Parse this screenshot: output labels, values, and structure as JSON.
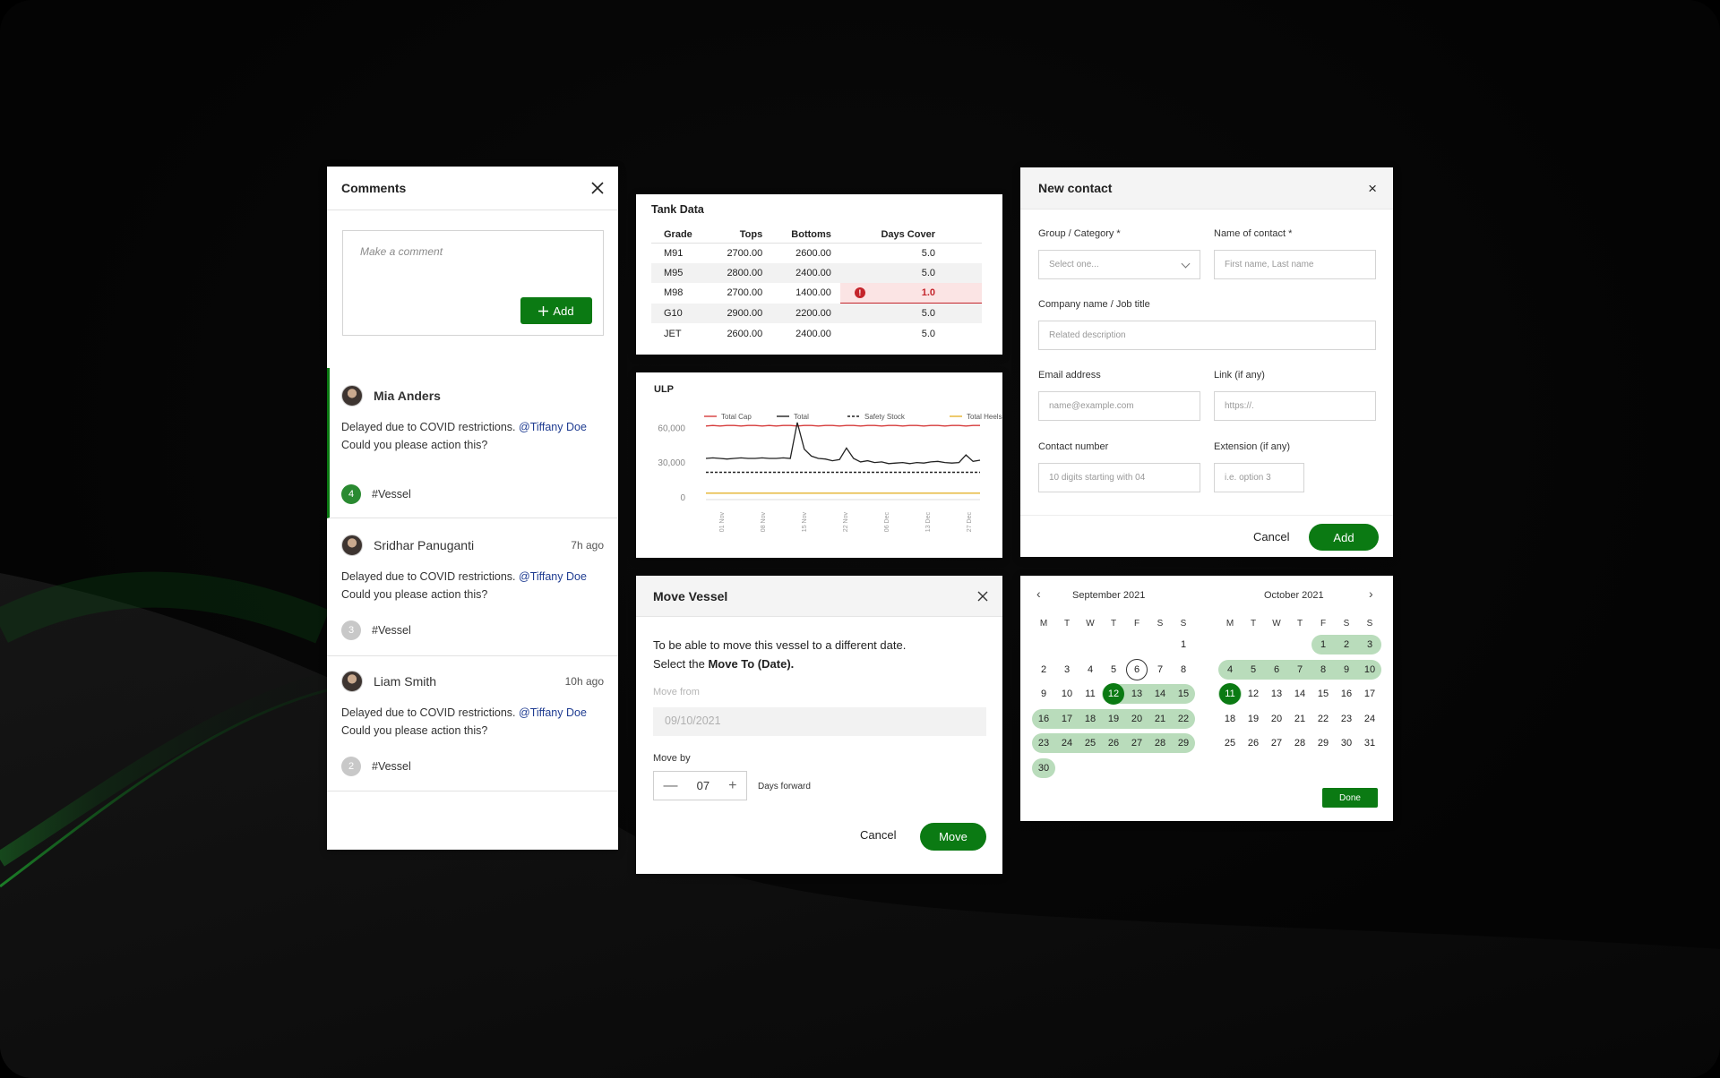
{
  "comments": {
    "title": "Comments",
    "placeholder": "Make a comment",
    "add_label": "Add",
    "items": [
      {
        "name": "Mia Anders",
        "time": "",
        "text1": "Delayed due to COVID restrictions. ",
        "mention": "@Tiffany Doe",
        "text2": "Could you please action this?",
        "count": "4",
        "tag": "#Vessel"
      },
      {
        "name": "Sridhar Panuganti",
        "time": "7h ago",
        "text1": "Delayed due to COVID restrictions. ",
        "mention": "@Tiffany Doe",
        "text2": "Could you please action this?",
        "count": "3",
        "tag": "#Vessel"
      },
      {
        "name": "Liam Smith",
        "time": "10h ago",
        "text1": "Delayed due to COVID restrictions. ",
        "mention": "@Tiffany Doe",
        "text2": "Could you please action this?",
        "count": "2",
        "tag": "#Vessel"
      }
    ]
  },
  "tank": {
    "title": "Tank Data",
    "headers": [
      "Grade",
      "Tops",
      "Bottoms",
      "Days Cover"
    ],
    "rows": [
      [
        "M91",
        "2700.00",
        "2600.00",
        "5.0"
      ],
      [
        "M95",
        "2800.00",
        "2400.00",
        "5.0"
      ],
      [
        "M98",
        "2700.00",
        "1400.00",
        "1.0"
      ],
      [
        "G10",
        "2900.00",
        "2200.00",
        "5.0"
      ],
      [
        "JET",
        "2600.00",
        "2400.00",
        "5.0"
      ]
    ],
    "warning_mark": "!"
  },
  "chart_data": {
    "type": "line",
    "title": "ULP",
    "x": [
      "01 Nov",
      "08 Nov",
      "15 Nov",
      "22 Nov",
      "06 Dec",
      "13 Dec",
      "27 Dec"
    ],
    "y_ticks": [
      "60,000",
      "30,000",
      "0"
    ],
    "ylim": [
      0,
      75000
    ],
    "series": [
      {
        "name": "Total Cap",
        "color": "#d63b3b",
        "style": "solid",
        "values": [
          62000,
          62500,
          62000,
          62500,
          62500,
          62000,
          62500,
          62500,
          62000,
          62500,
          62000,
          62500,
          62500,
          62000,
          62500,
          62500,
          62000,
          62500,
          62500,
          62000,
          62500,
          62500,
          62000,
          62500,
          62500,
          62000,
          62500,
          62500,
          62000,
          62500,
          62500,
          62000,
          62500,
          62500,
          62000,
          62500,
          62500,
          62000,
          62500,
          62500
        ]
      },
      {
        "name": "Total",
        "color": "#222222",
        "style": "solid",
        "values": [
          34000,
          34500,
          34000,
          33500,
          34000,
          34500,
          34000,
          34000,
          34500,
          34000,
          34000,
          34500,
          34000,
          65000,
          42000,
          36000,
          34000,
          33500,
          32000,
          33000,
          43000,
          34000,
          31000,
          32000,
          30500,
          31000,
          29500,
          30000,
          30500,
          29500,
          30500,
          30000,
          31000,
          31500,
          30500,
          30000,
          30500,
          37000,
          31500,
          32500
        ]
      },
      {
        "name": "Safety Stock",
        "color": "#222222",
        "style": "dashed",
        "values": [
          22000,
          22000,
          22000,
          22000,
          22000,
          22000,
          22000,
          22000,
          22000,
          22000,
          22000,
          22000,
          22000,
          22000,
          22000,
          22000,
          22000,
          22000,
          22000,
          22000,
          22000,
          22000,
          22000,
          22000,
          22000,
          22000,
          22000,
          22000,
          22000,
          22000,
          22000,
          22000,
          22000,
          22000,
          22000,
          22000,
          22000,
          22000,
          22000,
          22000
        ]
      },
      {
        "name": "Total Heels",
        "color": "#e5b32e",
        "style": "solid",
        "values": [
          4000,
          4000,
          4000,
          4000,
          4000,
          4000,
          4000,
          4000,
          4000,
          4000,
          4000,
          4000,
          4000,
          4000,
          4000,
          4000,
          4000,
          4000,
          4000,
          4000,
          4000,
          4000,
          4000,
          4000,
          4000,
          4000,
          4000,
          4000,
          4000,
          4000,
          4000,
          4000,
          4000,
          4000,
          4000,
          4000,
          4000,
          4000,
          4000,
          4000
        ]
      }
    ]
  },
  "move": {
    "title": "Move Vessel",
    "desc1": "To be able to move this vessel to a different date.",
    "desc2a": "Select the ",
    "desc2b": "Move To (Date).",
    "from_label": "Move from",
    "from_value": "09/10/2021",
    "by_label": "Move by",
    "by_value": "07",
    "minus": "—",
    "plus": "+",
    "unit": "Days forward",
    "cancel": "Cancel",
    "submit": "Move"
  },
  "contact": {
    "title": "New contact",
    "close": "×",
    "group_label": "Group / Category *",
    "group_placeholder": "Select one...",
    "name_label": "Name of contact *",
    "name_placeholder": "First name, Last name",
    "company_label": "Company name / Job title",
    "company_placeholder": "Related description",
    "email_label": "Email address",
    "email_placeholder": "name@example.com",
    "link_label": "Link (if any)",
    "link_placeholder": "https://.",
    "phone_label": "Contact number",
    "phone_placeholder": "10 digits starting with 04",
    "ext_label": "Extension (if any)",
    "ext_placeholder": "i.e. option 3",
    "cancel": "Cancel",
    "submit": "Add"
  },
  "calendar": {
    "prev": "‹",
    "next": "›",
    "dow": [
      "M",
      "T",
      "W",
      "T",
      "F",
      "S",
      "S"
    ],
    "done": "Done",
    "months": [
      {
        "label": "September 2021",
        "start_offset": 6,
        "days": 30,
        "range_from": 12,
        "range_to": 30,
        "selected": 12,
        "today": 6
      },
      {
        "label": "October 2021",
        "start_offset": 4,
        "days": 31,
        "range_from": 1,
        "range_to": 11,
        "selected": 11,
        "today": 0
      }
    ]
  },
  "colors": {
    "brand": "#0b7a13",
    "range": "#b9dcbb",
    "error": "#c4242b"
  }
}
